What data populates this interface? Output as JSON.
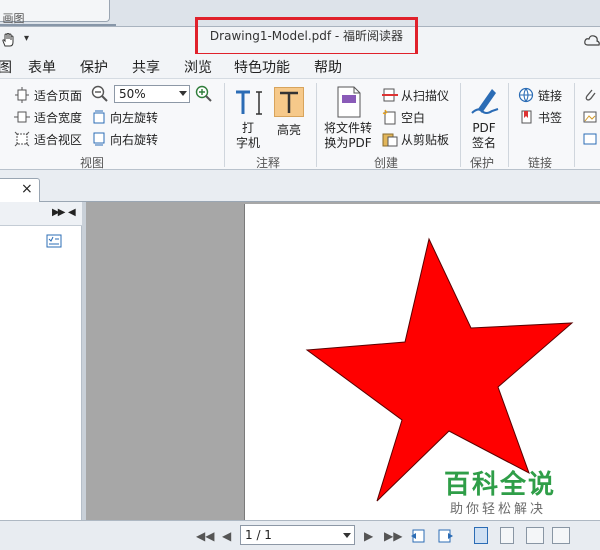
{
  "background_tab": {
    "title": "- 画图"
  },
  "window": {
    "title": "Drawing1-Model.pdf - 福昕阅读器",
    "highlight_color": "#e0212b"
  },
  "menu": [
    "图",
    "表单",
    "保护",
    "共享",
    "浏览",
    "特色功能",
    "帮助"
  ],
  "ribbon": {
    "view": {
      "fit_page": "适合页面",
      "fit_width": "适合宽度",
      "fit_view": "适合视区",
      "zoom_value": "50%",
      "rotate_left": "向左旋转",
      "rotate_right": "向右旋转",
      "label": "视图"
    },
    "comment": {
      "typewriter": "打\n字机",
      "highlight": "高亮",
      "label": "注释"
    },
    "create": {
      "convert": "将文件转\n换为PDF",
      "from_scanner": "从扫描仪",
      "blank": "空白",
      "from_clipboard": "从剪贴板",
      "label": "创建"
    },
    "protect": {
      "pdf_sign": "PDF\n签名",
      "label": "保护"
    },
    "links": {
      "link": "链接",
      "bookmark": "书签",
      "label": "链接"
    }
  },
  "document": {
    "star_color": "#ff0000"
  },
  "status": {
    "page_display": "1 / 1"
  },
  "watermark": {
    "title": "百科全说",
    "subtitle": "助你轻松解决",
    "color": "#2f9e48"
  }
}
